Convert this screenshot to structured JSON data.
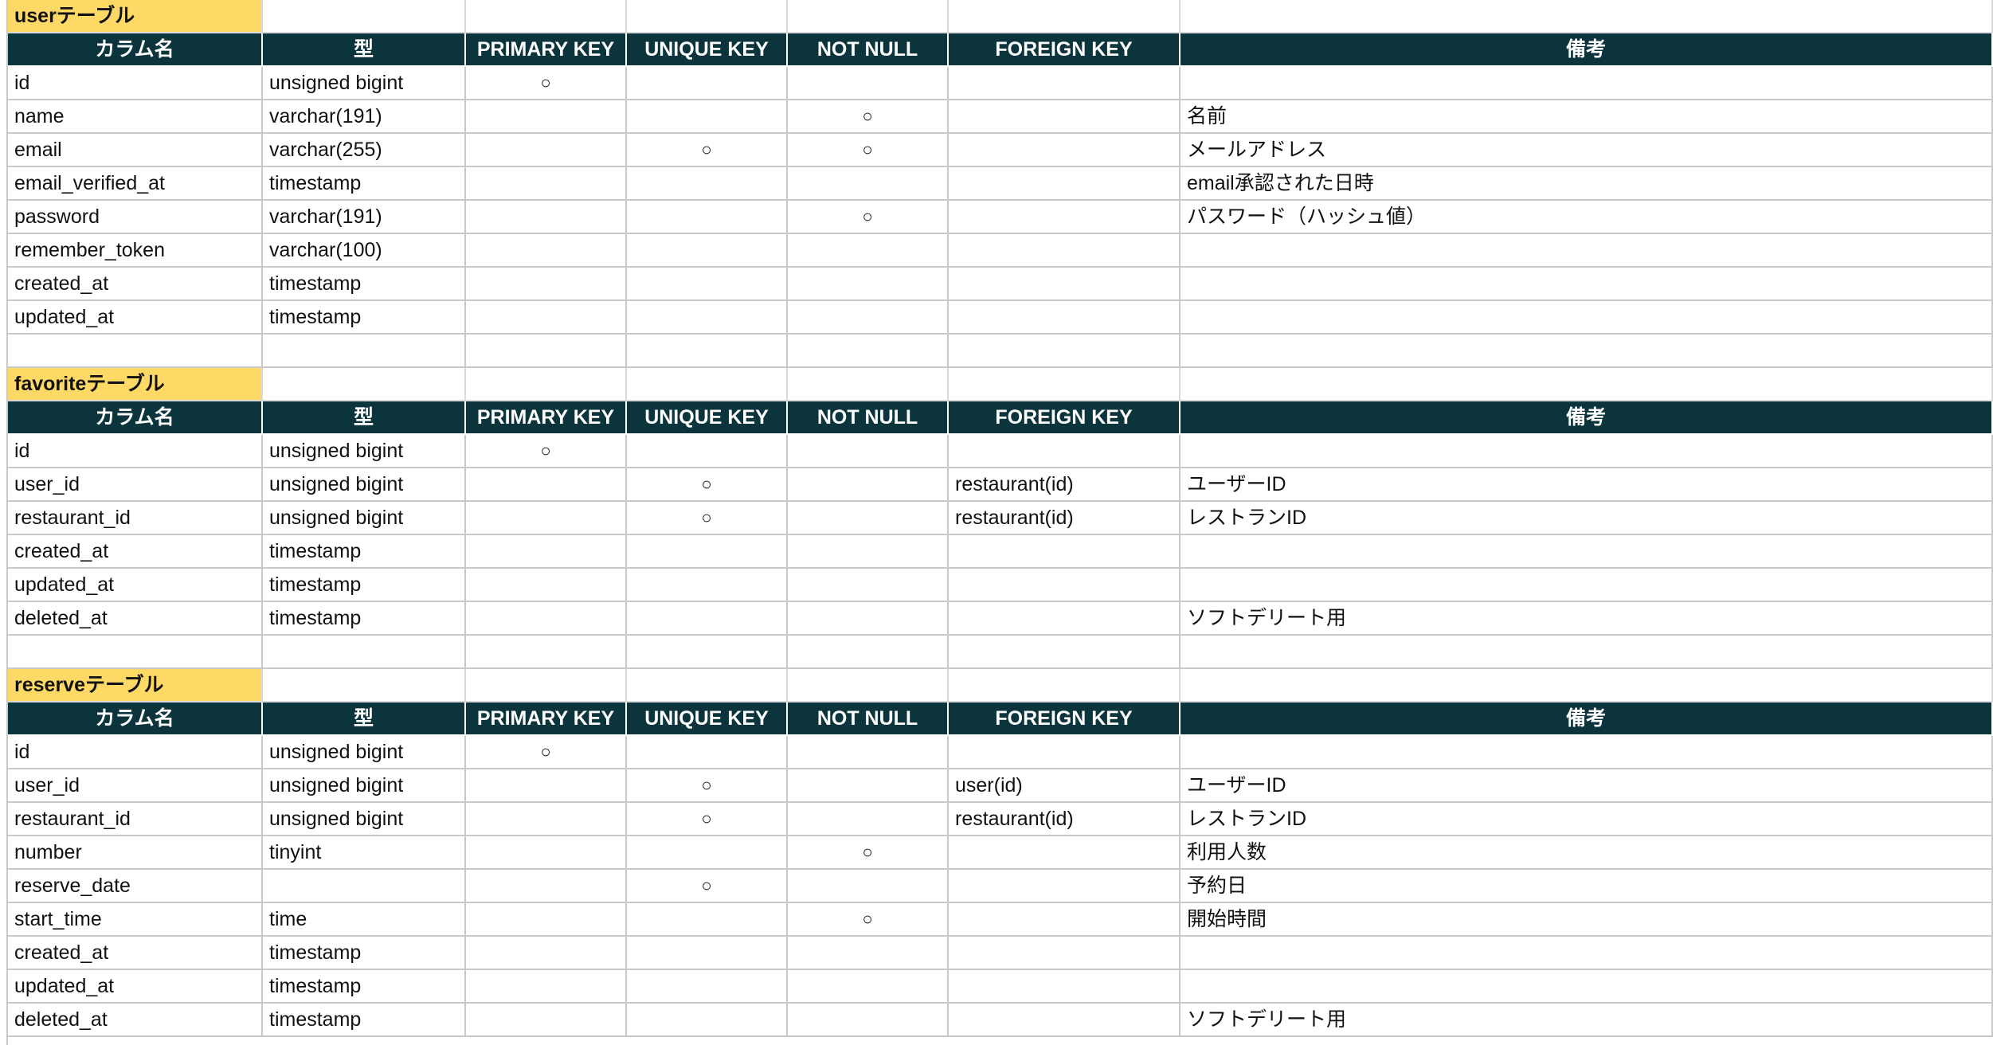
{
  "header_labels": [
    "カラム名",
    "型",
    "PRIMARY KEY",
    "UNIQUE KEY",
    "NOT NULL",
    "FOREIGN KEY",
    "備考"
  ],
  "mark": "○",
  "tables": [
    {
      "title": "userテーブル",
      "rows": [
        [
          "id",
          "unsigned bigint",
          "○",
          "",
          "",
          "",
          ""
        ],
        [
          "name",
          "varchar(191)",
          "",
          "",
          "○",
          "",
          "名前"
        ],
        [
          "email",
          "varchar(255)",
          "",
          "○",
          "○",
          "",
          "メールアドレス"
        ],
        [
          "email_verified_at",
          "timestamp",
          "",
          "",
          "",
          "",
          "email承認された日時"
        ],
        [
          "password",
          "varchar(191)",
          "",
          "",
          "○",
          "",
          "パスワード（ハッシュ値）"
        ],
        [
          "remember_token",
          "varchar(100)",
          "",
          "",
          "",
          "",
          ""
        ],
        [
          "created_at",
          "timestamp",
          "",
          "",
          "",
          "",
          ""
        ],
        [
          "updated_at",
          "timestamp",
          "",
          "",
          "",
          "",
          ""
        ]
      ]
    },
    {
      "title": "favoriteテーブル",
      "rows": [
        [
          "id",
          "unsigned bigint",
          "○",
          "",
          "",
          "",
          ""
        ],
        [
          "user_id",
          "unsigned bigint",
          "",
          "○",
          "",
          "restaurant(id)",
          "ユーザーID"
        ],
        [
          "restaurant_id",
          "unsigned bigint",
          "",
          "○",
          "",
          "restaurant(id)",
          "レストランID"
        ],
        [
          "created_at",
          "timestamp",
          "",
          "",
          "",
          "",
          ""
        ],
        [
          "updated_at",
          "timestamp",
          "",
          "",
          "",
          "",
          ""
        ],
        [
          "deleted_at",
          "timestamp",
          "",
          "",
          "",
          "",
          "ソフトデリート用"
        ]
      ]
    },
    {
      "title": "reserveテーブル",
      "rows": [
        [
          "id",
          "unsigned bigint",
          "○",
          "",
          "",
          "",
          ""
        ],
        [
          "user_id",
          "unsigned bigint",
          "",
          "○",
          "",
          "user(id)",
          "ユーザーID"
        ],
        [
          "restaurant_id",
          "unsigned bigint",
          "",
          "○",
          "",
          "restaurant(id)",
          "レストランID"
        ],
        [
          "number",
          "tinyint",
          "",
          "",
          "○",
          "",
          "利用人数"
        ],
        [
          "reserve_date",
          "",
          "",
          "○",
          "",
          "",
          "予約日"
        ],
        [
          "start_time",
          "time",
          "",
          "",
          "○",
          "",
          "開始時間"
        ],
        [
          "created_at",
          "timestamp",
          "",
          "",
          "",
          "",
          ""
        ],
        [
          "updated_at",
          "timestamp",
          "",
          "",
          "",
          "",
          ""
        ],
        [
          "deleted_at",
          "timestamp",
          "",
          "",
          "",
          "",
          "ソフトデリート用"
        ]
      ]
    }
  ]
}
